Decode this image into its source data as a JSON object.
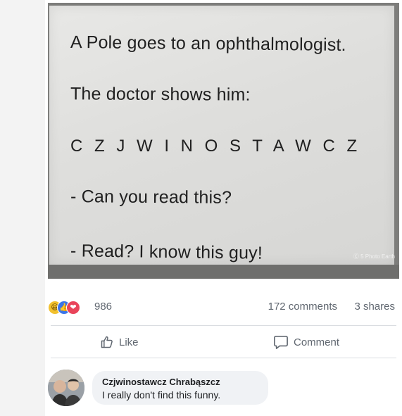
{
  "post": {
    "image_text": {
      "line1": "A Pole goes to an ophthalmologist.",
      "line2": "The doctor shows him:",
      "line3": "C Z J W I N O S T A W C Z",
      "line4": "- Can you read this?",
      "line5": "- Read? I know this guy!",
      "watermark": "Ⓒ 5 Photo Earth"
    },
    "stats": {
      "reaction_icons": [
        "haha-icon",
        "like-icon",
        "love-icon"
      ],
      "reactions": "986",
      "comments": "172 comments",
      "shares": "3 shares"
    },
    "actions": {
      "like": "Like",
      "comment": "Comment"
    },
    "comment": {
      "author": "Czjwinostawcz Chrabąszcz",
      "text": "I really don't find this funny."
    }
  },
  "colors": {
    "meta_text": "#606770",
    "bubble": "#f0f2f5",
    "like_blue": "#3b75e8",
    "love_red": "#e9445a",
    "haha_yellow": "#f2c12e"
  }
}
